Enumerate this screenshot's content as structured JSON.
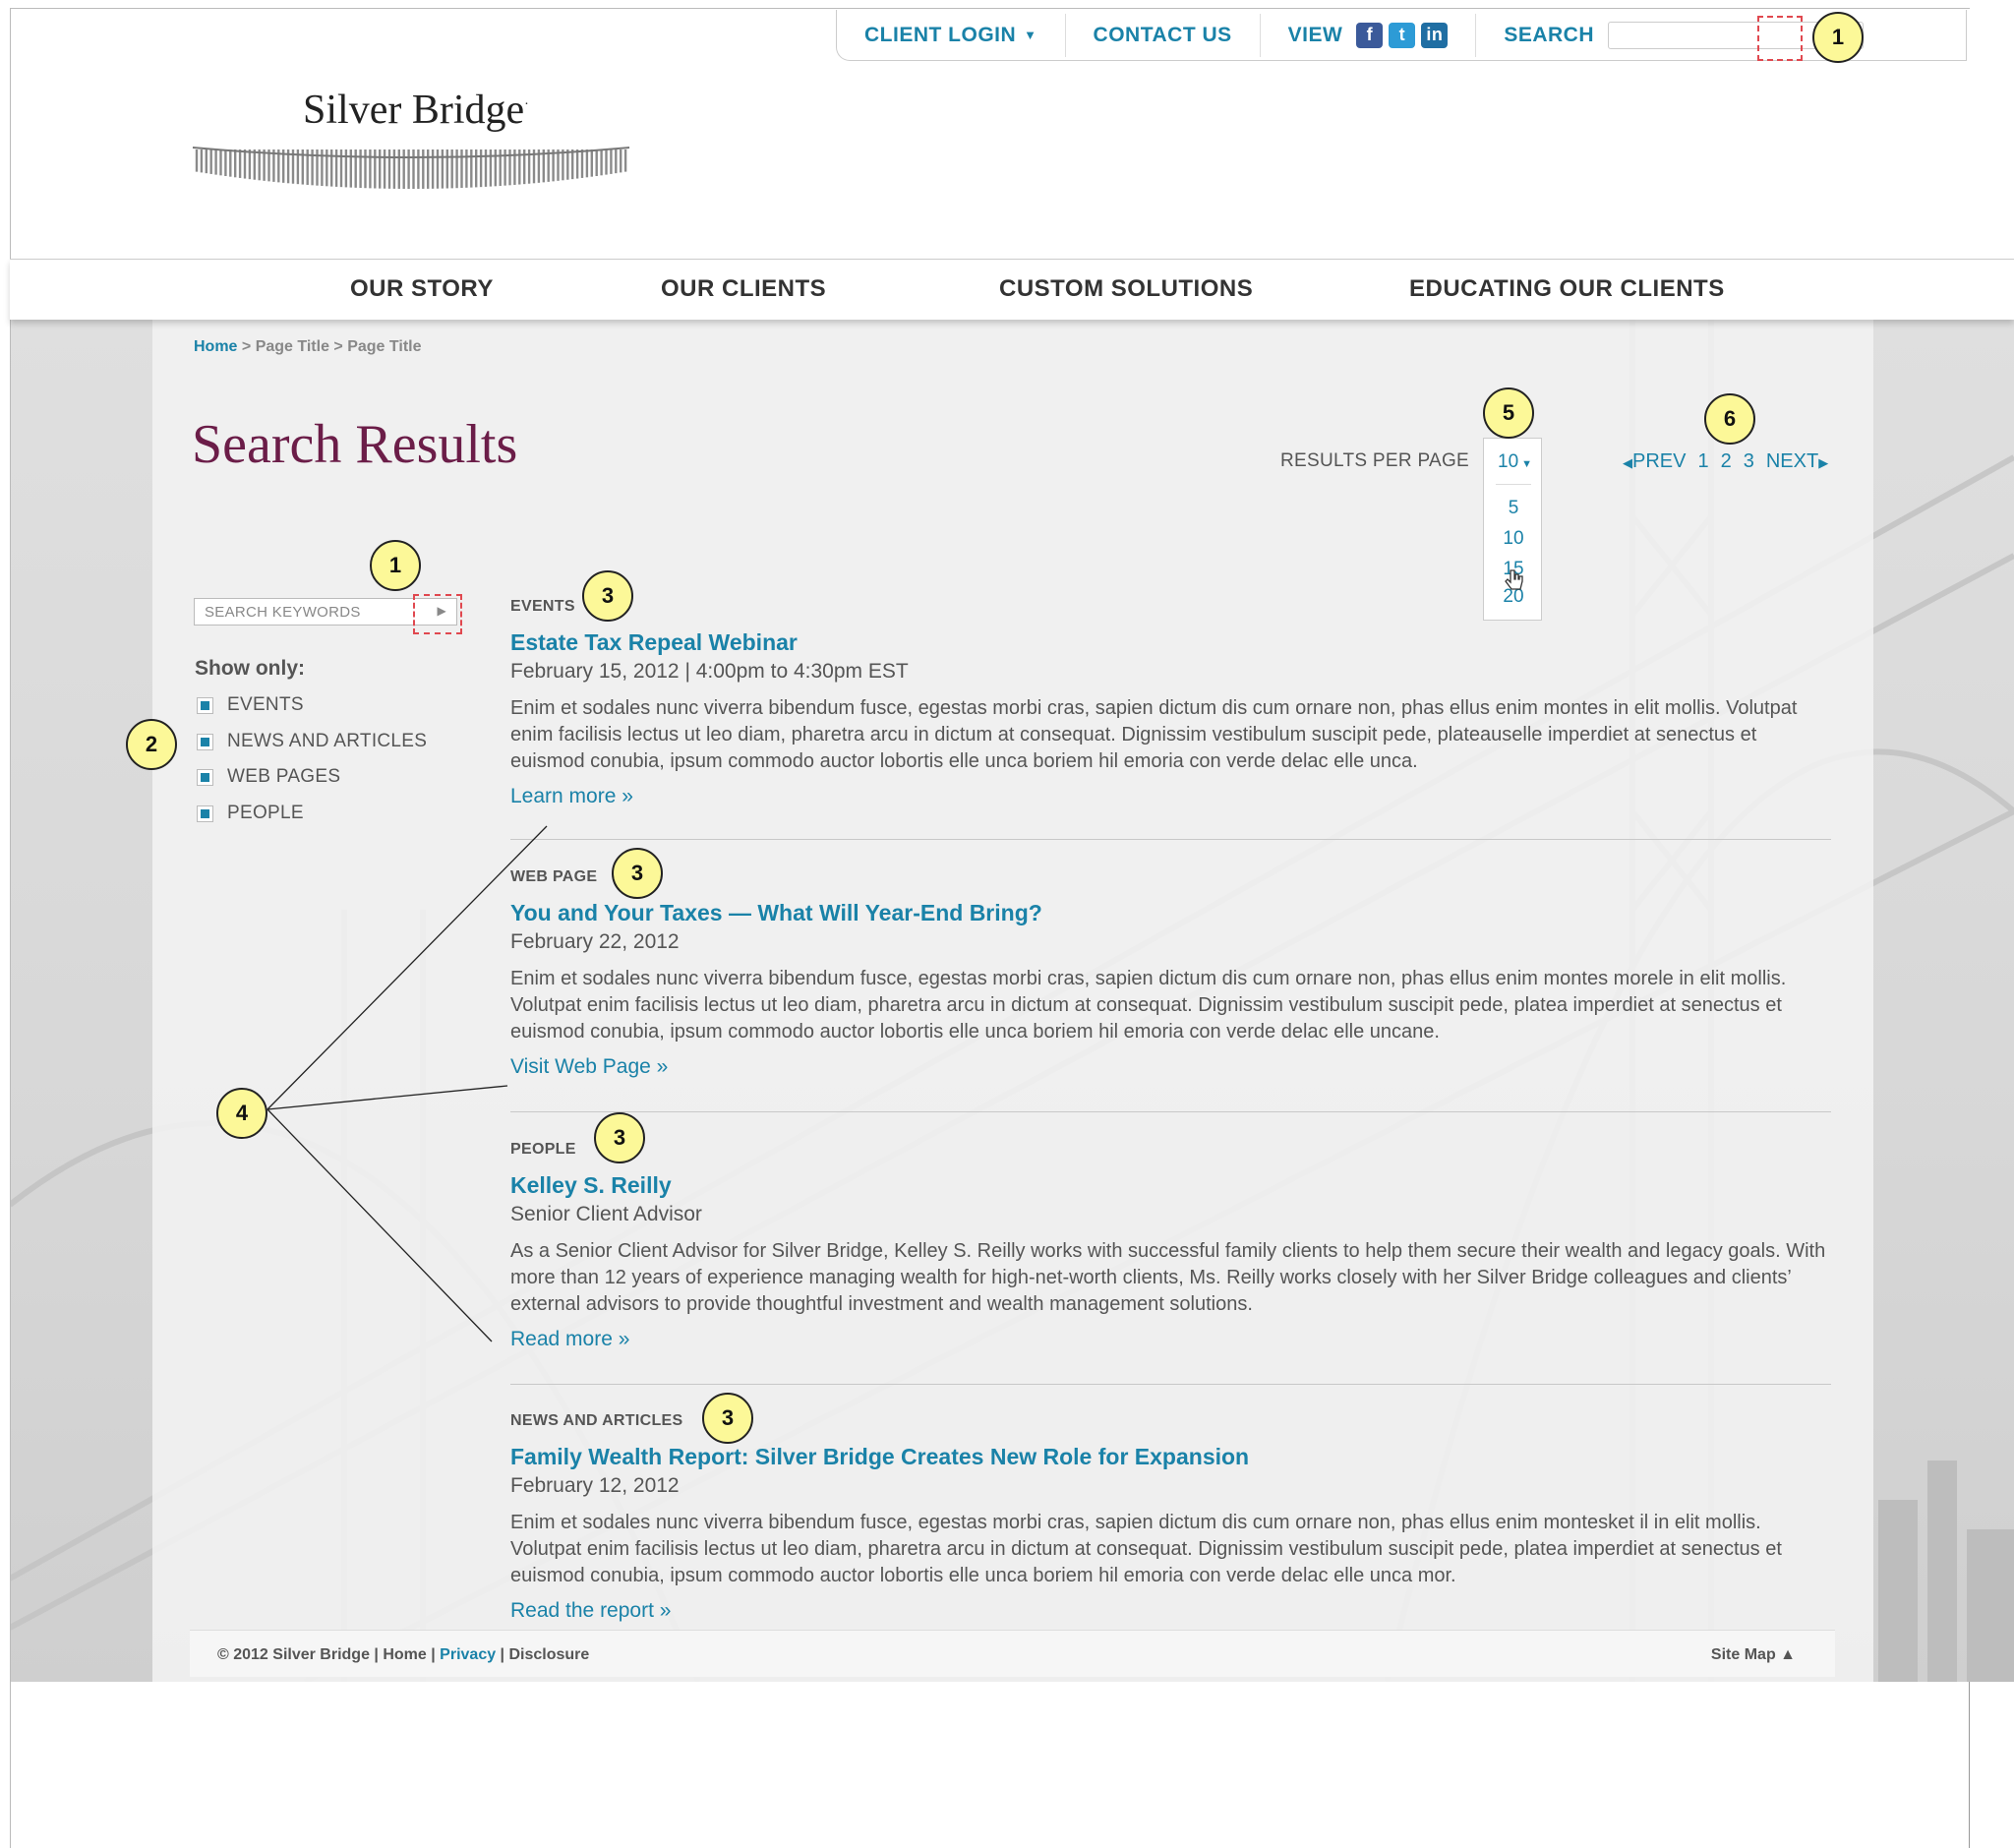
{
  "utility": {
    "client_login": "CLIENT LOGIN",
    "contact_us": "CONTACT US",
    "view": "VIEW",
    "search_label": "SEARCH",
    "social": {
      "facebook": "f",
      "twitter": "t",
      "linkedin": "in"
    }
  },
  "logo": {
    "name": "Silver Bridge",
    "mark": "·"
  },
  "nav": [
    "OUR STORY",
    "OUR CLIENTS",
    "CUSTOM SOLUTIONS",
    "EDUCATING OUR CLIENTS"
  ],
  "breadcrumb": {
    "home": "Home",
    "rest": " > Page Title > Page Title"
  },
  "page_title": "Search Results",
  "results_per_page": {
    "label": "RESULTS PER PAGE",
    "selected": "10",
    "options": [
      "5",
      "10",
      "15",
      "20"
    ]
  },
  "pager": {
    "prev": "PREV",
    "pages": [
      "1",
      "2",
      "3"
    ],
    "next": "NEXT"
  },
  "sidebar": {
    "search_placeholder": "SEARCH KEYWORDS",
    "show_only_label": "Show only:",
    "filters": [
      "EVENTS",
      "NEWS AND ARTICLES",
      "WEB PAGES",
      "PEOPLE"
    ]
  },
  "results": [
    {
      "type": "EVENTS",
      "title": "Estate Tax Repeal Webinar",
      "subtitle": "February 15, 2012  |  4:00pm to 4:30pm EST",
      "body": "Enim et sodales nunc viverra bibendum fusce, egestas morbi cras, sapien dictum dis cum ornare non, phas ellus enim montes in elit mollis. Volutpat enim facilisis lectus ut leo diam, pharetra arcu in dictum at consequat. Dignissim vestibulum suscipit pede, plateauselle imperdiet at senectus et euismod conubia, ipsum commodo auctor lobortis elle unca boriem hil emoria con verde delac elle unca.",
      "link": "Learn more »"
    },
    {
      "type": "WEB PAGE",
      "title": "You and Your Taxes — What Will Year-End Bring?",
      "subtitle": "February 22, 2012",
      "body": "Enim et sodales nunc viverra bibendum fusce, egestas morbi cras, sapien dictum dis cum ornare non, phas ellus enim montes morele in elit mollis. Volutpat enim facilisis lectus ut leo diam, pharetra arcu in dictum at consequat. Dignissim vestibulum suscipit pede, platea imperdiet at senectus et euismod conubia, ipsum commodo auctor lobortis elle unca boriem hil emoria con verde delac elle uncane.",
      "link": "Visit Web Page »"
    },
    {
      "type": "PEOPLE",
      "title": "Kelley S. Reilly",
      "subtitle": "Senior Client Advisor",
      "body": "As a Senior Client Advisor for Silver Bridge, Kelley S. Reilly works with successful family clients to help them secure their wealth and legacy goals. With more than 12 years of experience managing wealth for high-net-worth clients, Ms. Reilly works closely with her Silver Bridge colleagues and clients’ external advisors to provide thoughtful investment and wealth management solutions.",
      "link": "Read more »"
    },
    {
      "type": "NEWS AND ARTICLES",
      "title": "Family Wealth Report: Silver Bridge Creates New Role for Expansion",
      "subtitle": "February 12, 2012",
      "body": "Enim et sodales nunc viverra bibendum fusce, egestas morbi cras, sapien dictum dis cum ornare non, phas ellus enim montesket il in elit mollis. Volutpat enim facilisis lectus ut leo diam, pharetra arcu in dictum at consequat. Dignissim vestibulum suscipit pede, platea imperdiet at senectus et euismod conubia, ipsum commodo auctor lobortis elle unca boriem hil emoria con verde delac elle unca mor.",
      "link": "Read the report »"
    }
  ],
  "footer": {
    "copyright": "© 2012 Silver Bridge | ",
    "home": "Home",
    "privacy": "Privacy",
    "disclosure": "Disclosure",
    "site_map": "Site Map ▲"
  },
  "annotations": {
    "one": "1",
    "two": "2",
    "three": "3",
    "four": "4",
    "five": "5",
    "six": "6"
  },
  "colors": {
    "link": "#1a82a8",
    "title": "#6b1d48",
    "badge": "#fcf898",
    "dash": "#e0484f"
  }
}
